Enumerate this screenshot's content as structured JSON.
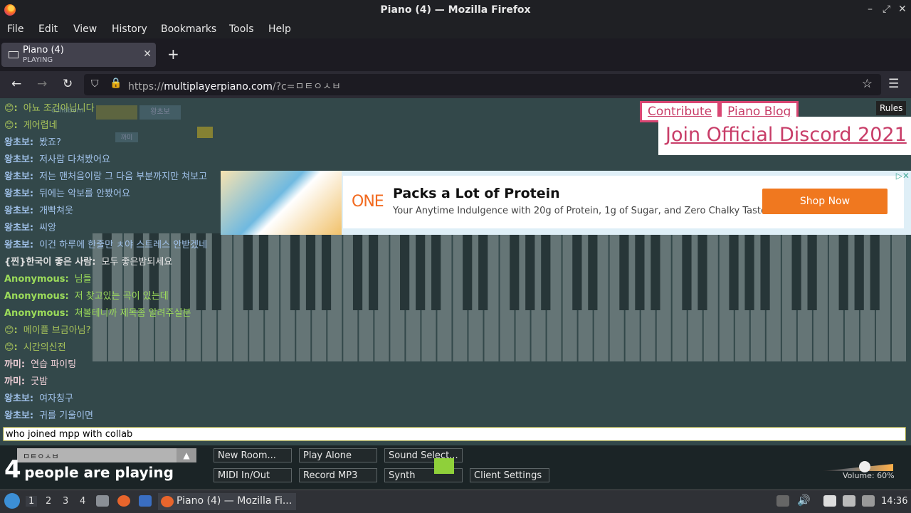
{
  "window": {
    "title": "Piano (4) — Mozilla Firefox"
  },
  "menu": [
    "File",
    "Edit",
    "View",
    "History",
    "Bookmarks",
    "Tools",
    "Help"
  ],
  "tab": {
    "title": "Piano (4)",
    "subtitle": "PLAYING"
  },
  "url": {
    "prefix": "https://",
    "host": "multiplayerpiano.com",
    "path": "/?c=ㅁㅌㅇㅅㅂ"
  },
  "chat": [
    {
      "name": "😊:",
      "text": "아뇨 조건아닙니다",
      "color": "#a8c45a"
    },
    {
      "name": "😊:",
      "text": "게어렵네",
      "color": "#a8c45a"
    },
    {
      "name": "왕초보:",
      "text": "봤죠?",
      "color": "#9fc0e8"
    },
    {
      "name": "왕초보:",
      "text": "저사람 다쳐봤어요",
      "color": "#9fc0e8"
    },
    {
      "name": "왕초보:",
      "text": "저는 맨처음이랑 그 다음 부분까지만 쳐보고",
      "color": "#9fc0e8"
    },
    {
      "name": "왕초보:",
      "text": "뒤에는 악보를 안봤어요",
      "color": "#9fc0e8"
    },
    {
      "name": "왕초보:",
      "text": "개빡쳐웃",
      "color": "#9fc0e8"
    },
    {
      "name": "왕초보:",
      "text": "씨앙",
      "color": "#9fc0e8"
    },
    {
      "name": "왕초보:",
      "text": "이건 하루에 한줄만 ㅊ야 스트레스 안받겠네",
      "color": "#9fc0e8"
    },
    {
      "name": "{찐}한국이 좋은 사람:",
      "text": "모두 좋은밤되세요",
      "color": "#e0e0e0"
    },
    {
      "name": "Anonymous:",
      "text": "님들",
      "color": "#9cdc5a"
    },
    {
      "name": "Anonymous:",
      "text": "저 찾고있는 곡이 있는데",
      "color": "#9cdc5a"
    },
    {
      "name": "Anonymous:",
      "text": "쳐볼테니까 제목좀 알려주실분",
      "color": "#9cdc5a"
    },
    {
      "name": "😊:",
      "text": "메이플 브금아님?",
      "color": "#a8c45a"
    },
    {
      "name": "😊:",
      "text": "시간의신전",
      "color": "#a8c45a"
    },
    {
      "name": "까미:",
      "text": "연습 파이팅",
      "color": "#f0d0d8"
    },
    {
      "name": "까미:",
      "text": "굿밤",
      "color": "#f0d0d8"
    },
    {
      "name": "왕초보:",
      "text": "여자칭구",
      "color": "#9fc0e8"
    },
    {
      "name": "왕초보:",
      "text": "귀를 기울이면",
      "color": "#9fc0e8"
    }
  ],
  "cursors": {
    "name": "collabvm",
    "tag1": "왕초보",
    "tag2": "까미"
  },
  "links": {
    "contribute": "Contribute",
    "blog": "Piano Blog",
    "discord": "Join Official Discord 2021",
    "rules": "Rules"
  },
  "ad": {
    "brand": "ONE",
    "headline": "Packs a Lot of Protein",
    "sub": "Your Anytime Indulgence with 20g of Protein, 1g of Sugar, and Zero Chalky Taste.",
    "cta": "Shop Now"
  },
  "chat_input": "who joined mpp with collab",
  "room": {
    "name": "ㅁㅌㅇㅅㅂ"
  },
  "count": {
    "num": "4",
    "text": "people are playing"
  },
  "buttons": {
    "new_room": "New Room...",
    "play_alone": "Play Alone",
    "sound_select": "Sound Select...",
    "midi": "MIDI In/Out",
    "record": "Record MP3",
    "synth": "Synth",
    "client_settings": "Client Settings"
  },
  "volume": {
    "label": "Volume: 60%",
    "value": 0.6
  },
  "taskbar": {
    "workspaces": [
      "1",
      "2",
      "3",
      "4"
    ],
    "task": "Piano (4) — Mozilla Fi...",
    "clock": "14:36"
  }
}
